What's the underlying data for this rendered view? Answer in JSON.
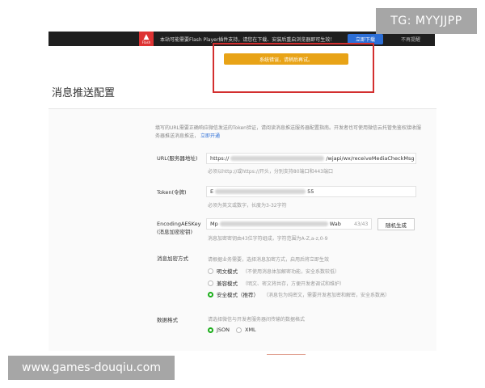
{
  "banner": {
    "warn_small": "Flash",
    "message": "本站可能需要Flash Player插件支持，请您在下载、安装后重启浏览器即可生效！",
    "download": "立即下载",
    "dismiss": "不再提醒"
  },
  "watermarks": {
    "tg": "TG: MYYJJPP",
    "site": "www.games-douqiu.com"
  },
  "notice": "系统错误，请稍后再试。",
  "page": {
    "title": "消息推送配置"
  },
  "intro": {
    "text": "填写的URL需要正确响应微信发送的Token验证，请阅读消息推送服务器配置指南。开发者也可使用微信云托管免鉴权接收服务器推送消息推送，",
    "link": "立即开通"
  },
  "form": {
    "url": {
      "label": "URL(服务器地址)",
      "value_prefix": "https://",
      "value_suffix": "/wjapi/wx/receiveMediaCheckMsg",
      "hint": "必须以http://或https://开头，分别支持80端口和443端口"
    },
    "token": {
      "label": "Token(令牌)",
      "value_prefix": "E",
      "value_suffix": "55",
      "hint": "必须为英文或数字，长度为3-32字符"
    },
    "aeskey": {
      "label_line1": "EncodingAESKey",
      "label_line2": "(消息加密密钥)",
      "value_prefix": "Mp",
      "value_suffix": "Wab",
      "counter": "43/43",
      "generate": "随机生成",
      "hint": "消息加密密钥由43位字符组成，字符范围为A-Z,a-z,0-9"
    },
    "encrypt": {
      "label": "消息加密方式",
      "hint": "请根据业务需要，选择消息加密方式，启用后将立即生效",
      "options": [
        {
          "label": "明文模式",
          "desc": "（不使用消息体加解密功能，安全系数较低）",
          "checked": false
        },
        {
          "label": "兼容模式",
          "desc": "（明文、密文将共存，方便开发者调试和维护）",
          "checked": false
        },
        {
          "label": "安全模式（推荐）",
          "desc": "（消息包为纯密文，需要开发者加密和解密，安全系数高）",
          "checked": true
        }
      ]
    },
    "format": {
      "label": "数据格式",
      "hint": "请选择微信与开发者服务器间传输的数据格式",
      "options": [
        {
          "label": "JSON",
          "checked": true
        },
        {
          "label": "XML",
          "checked": false
        }
      ]
    }
  },
  "colors": {
    "accent_green": "#1aad19",
    "warning_orange": "#e8a317",
    "highlight_red": "#d32f2f",
    "link_blue": "#2c6ed6"
  }
}
